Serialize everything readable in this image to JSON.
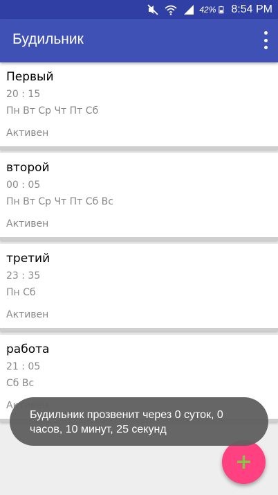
{
  "status_bar": {
    "battery_percent": "42%",
    "time": "8:54 PM",
    "icons": [
      "mute-icon",
      "wifi-icon",
      "signal-icon",
      "battery-icon"
    ]
  },
  "app_bar": {
    "title": "Будильник",
    "overflow_icon": "more-vert-icon"
  },
  "alarms": [
    {
      "name": "Первый",
      "time": "20 : 15",
      "days": "Пн Вт Ср Чт Пт Сб",
      "status": "Активен"
    },
    {
      "name": "второй",
      "time": "00 : 05",
      "days": "Пн Вт Ср Чт Пт Сб Вс",
      "status": "Активен"
    },
    {
      "name": "третий",
      "time": "23 : 35",
      "days": "Пн Сб",
      "status": "Активен"
    },
    {
      "name": "работа",
      "time": "21 : 05",
      "days": "Сб Вс",
      "status": "Активен"
    }
  ],
  "toast": {
    "message": "Будильник прозвенит через 0 суток, 0 часов, 10 минут, 25 секунд"
  },
  "fab": {
    "label": "+",
    "icon": "add-icon",
    "color": "#ff4081"
  }
}
